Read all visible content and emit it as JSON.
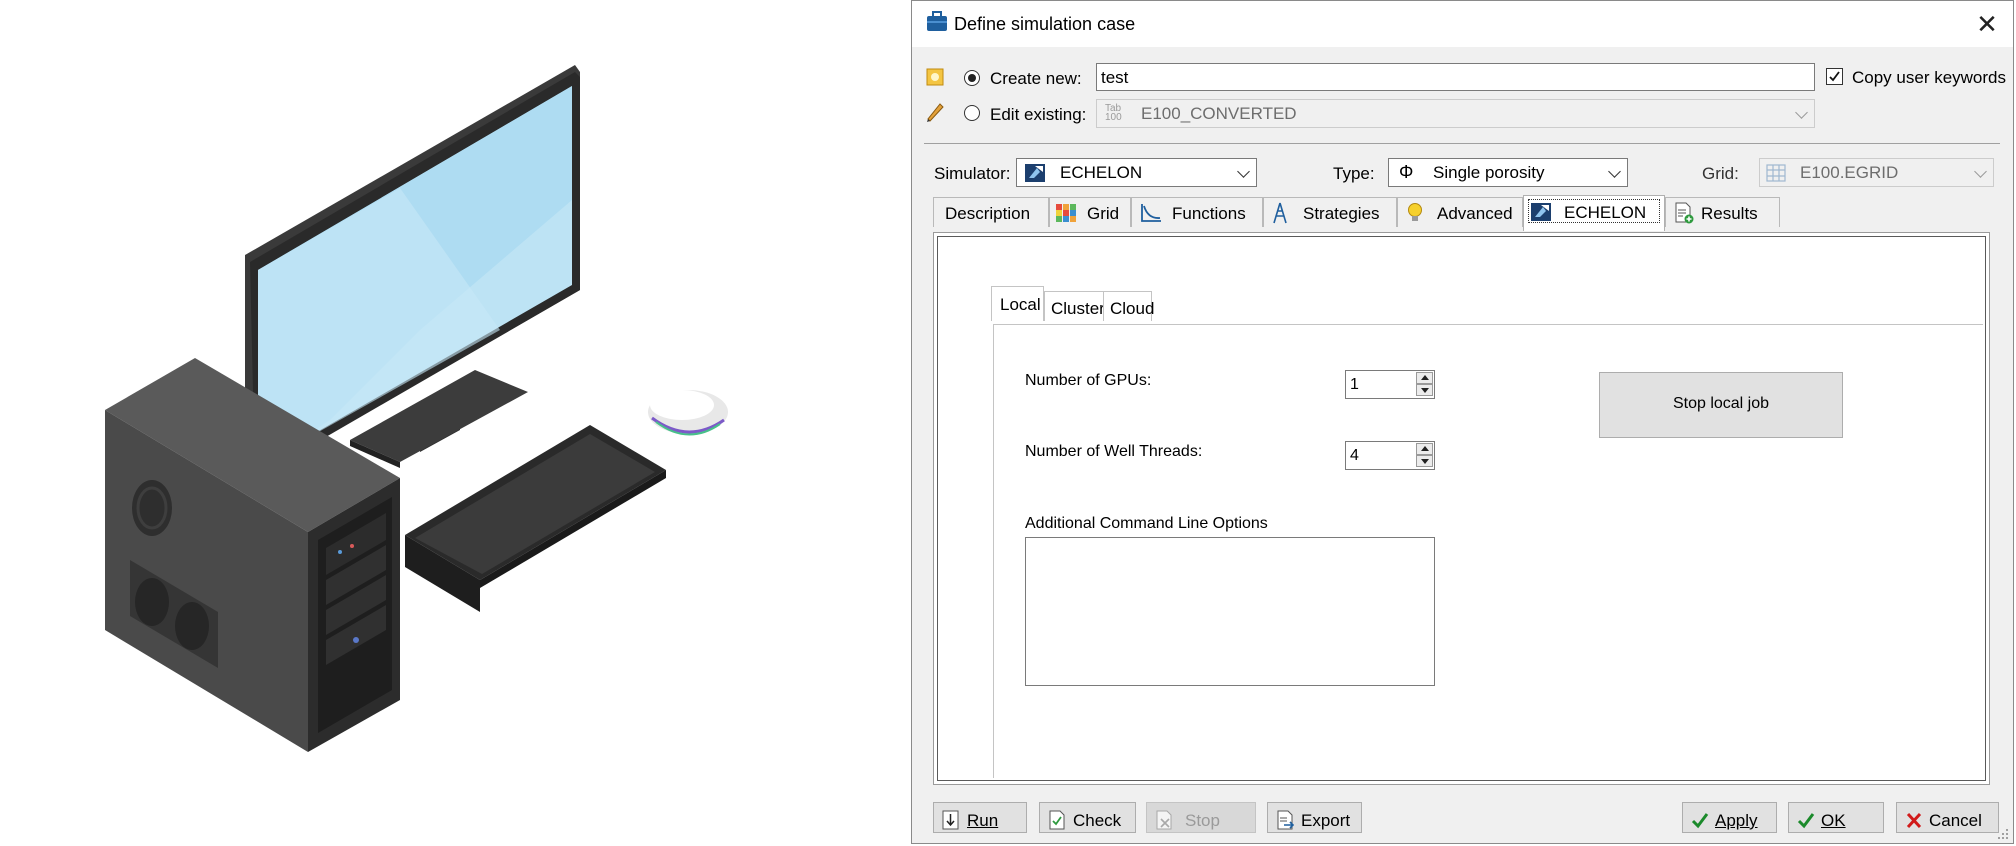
{
  "dialog": {
    "title": "Define simulation case",
    "create_new_label": "Create new:",
    "create_new_value": "test",
    "copy_user_keywords_label": "Copy user keywords",
    "edit_existing_label": "Edit existing:",
    "edit_existing_value": "E100_CONVERTED",
    "simulator_label": "Simulator:",
    "simulator_value": "ECHELON",
    "type_label": "Type:",
    "type_value": "Single porosity",
    "grid_label": "Grid:",
    "grid_value": "E100.EGRID"
  },
  "tabs": [
    "Description",
    "Grid",
    "Functions",
    "Strategies",
    "Advanced",
    "ECHELON",
    "Results"
  ],
  "active_tab": "ECHELON",
  "subtabs": [
    "Local",
    "Cluster",
    "Cloud"
  ],
  "active_subtab": "Local",
  "local": {
    "gpus_label": "Number of GPUs:",
    "gpus_value": "1",
    "threads_label": "Number of Well Threads:",
    "threads_value": "4",
    "options_label": "Additional Command Line Options",
    "options_value": "",
    "stop_button": "Stop local job"
  },
  "footer": {
    "run": "Run",
    "check": "Check",
    "stop": "Stop",
    "export": "Export",
    "apply": "Apply",
    "ok": "OK",
    "cancel": "Cancel"
  },
  "colors": {
    "accent": "#1a5fb4",
    "window_bg": "#f0f0f0",
    "ok_green": "#1b8a2b",
    "cancel_red": "#d11a1a"
  }
}
